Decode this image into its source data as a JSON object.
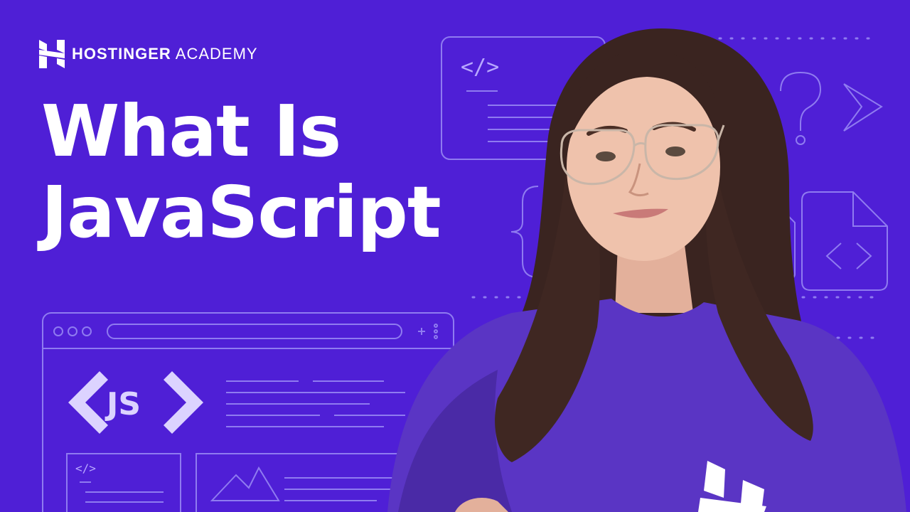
{
  "brand": {
    "name_bold": "HOSTINGER",
    "name_light": "ACADEMY"
  },
  "headline": {
    "line1": "What Is",
    "line2": "JavaScript"
  },
  "mockups": {
    "js_badge": "JS",
    "code_glyph": "</>",
    "brace_glyph": "{",
    "question_glyph": "?"
  },
  "icons": [
    "hostinger-logo-icon",
    "code-window-icon",
    "question-mark-icon",
    "chevron-left-icon",
    "chevron-right-icon",
    "curly-brace-icon",
    "code-file-icon",
    "browser-window-icon",
    "mountain-image-icon"
  ],
  "colors": {
    "background": "#4f1fd6",
    "outline": "#8f7bf0",
    "text": "#ffffff",
    "sweater": "#5a35c4",
    "hair": "#3a2420"
  }
}
